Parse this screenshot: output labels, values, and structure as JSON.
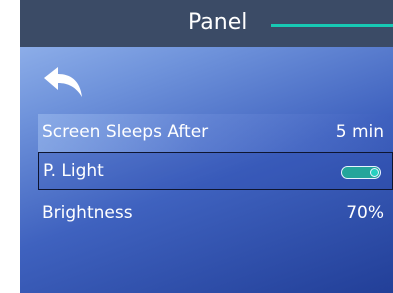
{
  "header": {
    "title": "Panel",
    "accent_color": "#17c9b4"
  },
  "back": {
    "icon": "back-arrow-icon"
  },
  "settings": [
    {
      "label": "Screen Sleeps After",
      "value": "5 min"
    },
    {
      "label": "P. Light",
      "toggle": "on"
    },
    {
      "label": "Brightness",
      "value": "70%"
    }
  ],
  "colors": {
    "header_bg": "#3b4b66",
    "toggle_on": "#24a59b"
  }
}
